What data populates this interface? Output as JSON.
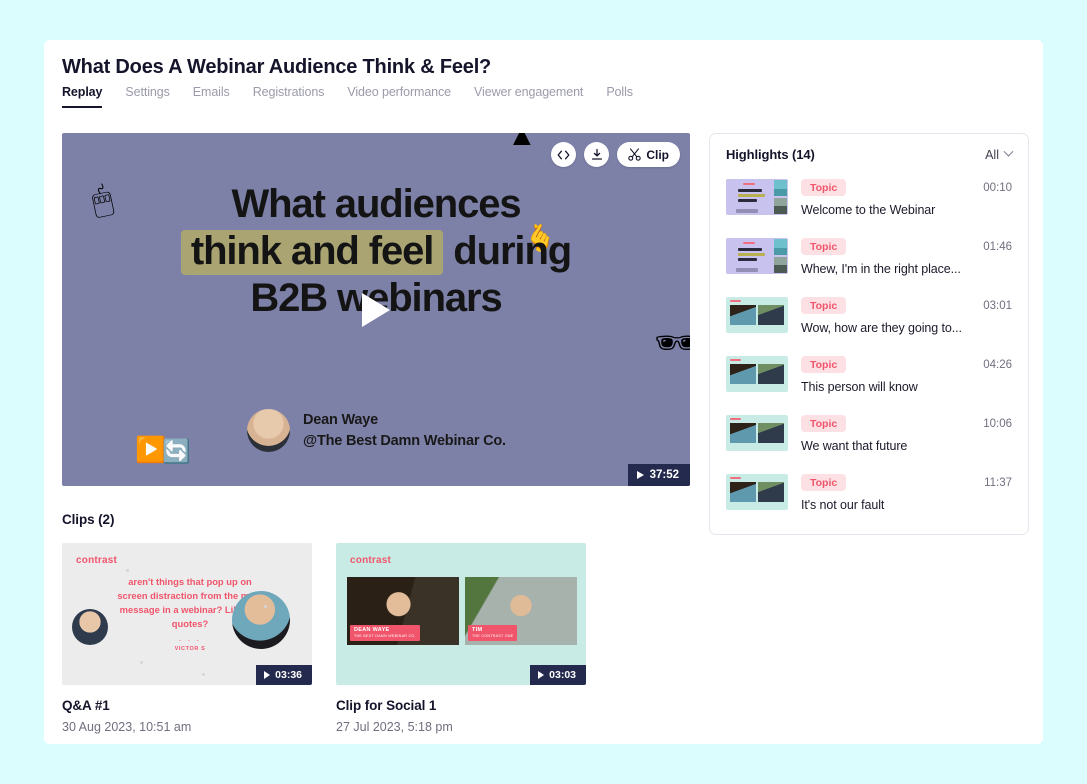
{
  "header": {
    "title": "What Does A Webinar Audience Think & Feel?",
    "tabs": [
      {
        "label": "Replay",
        "active": true
      },
      {
        "label": "Settings",
        "active": false
      },
      {
        "label": "Emails",
        "active": false
      },
      {
        "label": "Registrations",
        "active": false
      },
      {
        "label": "Video performance",
        "active": false
      },
      {
        "label": "Viewer engagement",
        "active": false
      },
      {
        "label": "Polls",
        "active": false
      }
    ]
  },
  "player": {
    "toolbar": {
      "embed_icon": "code-icon",
      "download_icon": "download-icon",
      "clip_icon": "scissors-icon",
      "clip_label": "Clip"
    },
    "slide": {
      "line1": "What audiences",
      "line2_highlight": "think and feel",
      "line2_rest": "during",
      "line3": "B2B webinars"
    },
    "presenter": {
      "name": "Dean Waye",
      "handle": "@The Best Damn Webinar Co."
    },
    "duration": "37:52",
    "background_color": "#7d81a8",
    "highlight_color": "#a9a472"
  },
  "highlights": {
    "title": "Highlights (14)",
    "filter_label": "All",
    "items": [
      {
        "badge": "Topic",
        "time": "00:10",
        "label": "Welcome to the Webinar",
        "thumb": "slide"
      },
      {
        "badge": "Topic",
        "time": "01:46",
        "label": "Whew, I'm in the right place...",
        "thumb": "slide"
      },
      {
        "badge": "Topic",
        "time": "03:01",
        "label": "Wow, how are they going to...",
        "thumb": "duo"
      },
      {
        "badge": "Topic",
        "time": "04:26",
        "label": "This person will know",
        "thumb": "duo"
      },
      {
        "badge": "Topic",
        "time": "10:06",
        "label": "We want that future",
        "thumb": "duo"
      },
      {
        "badge": "Topic",
        "time": "11:37",
        "label": "It's not our fault",
        "thumb": "duo"
      }
    ],
    "badge_bg": "#fde0e4",
    "badge_color": "#f0556c"
  },
  "clips": {
    "title": "Clips (2)",
    "items": [
      {
        "name": "Q&A #1",
        "date": "30 Aug 2023, 10:51 am",
        "duration": "03:36",
        "brand": "contrast",
        "quote": "aren't things that pop up on screen distraction from the main message in a webinar? Like the quotes?",
        "dots": "· · ·",
        "attribution": "VICTOR S"
      },
      {
        "name": "Clip for Social 1",
        "date": "27 Jul 2023, 5:18 pm",
        "duration": "03:03",
        "brand": "contrast",
        "speaker1": "DEAN WAYE",
        "speaker1_sub": "THE BEST DAMN WEBINAR CO.",
        "speaker2": "TIM",
        "speaker2_sub": "THE CONTRAST ONE"
      }
    ]
  }
}
